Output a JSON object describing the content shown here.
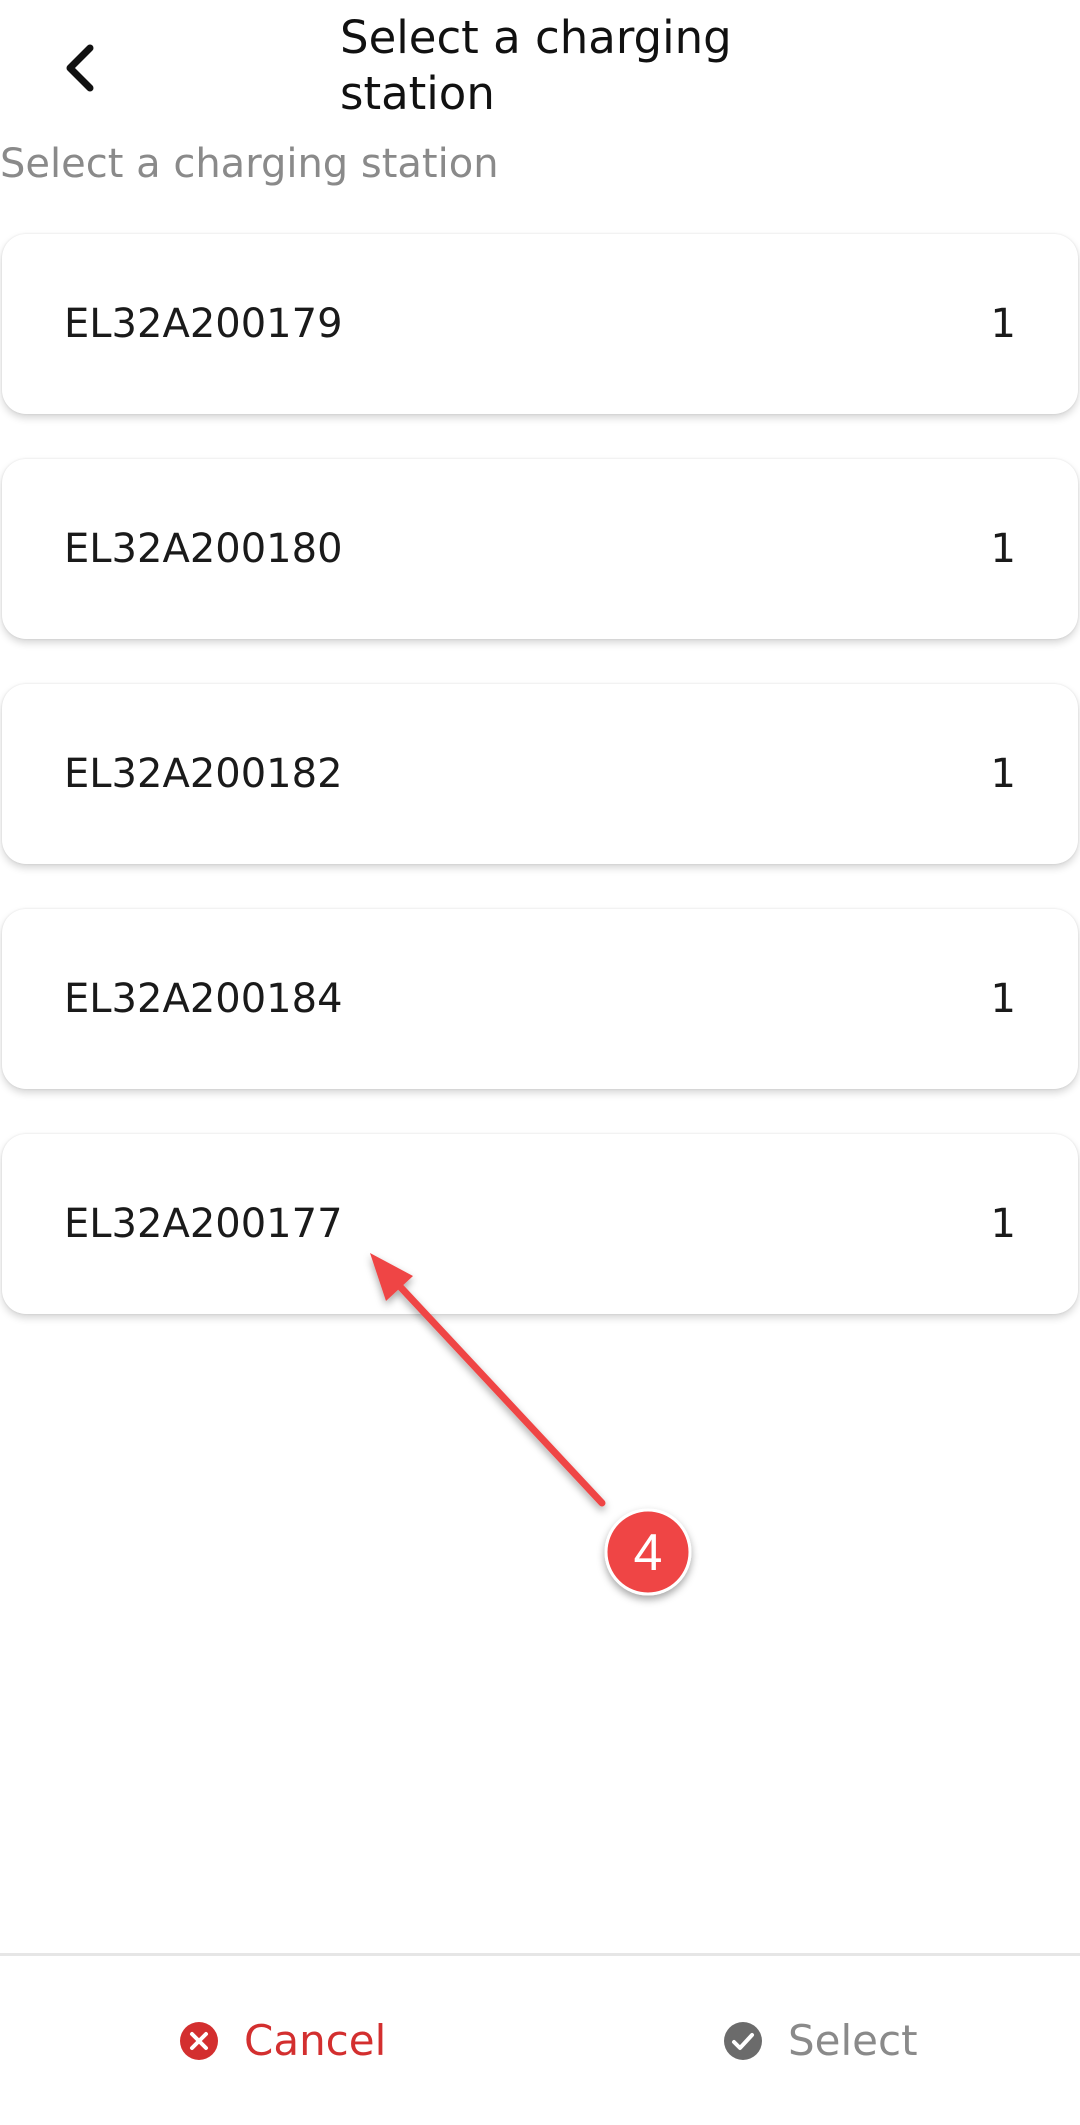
{
  "header": {
    "title": "Select a charging station",
    "back_icon": "chevron-left-icon"
  },
  "subtitle": "Select a charging station",
  "stations": [
    {
      "id": "EL32A200179",
      "count": "1"
    },
    {
      "id": "EL32A200180",
      "count": "1"
    },
    {
      "id": "EL32A200182",
      "count": "1"
    },
    {
      "id": "EL32A200184",
      "count": "1"
    },
    {
      "id": "EL32A200177",
      "count": "1"
    }
  ],
  "annotation": {
    "step_number": "4",
    "color": "#ef4444"
  },
  "footer": {
    "cancel_label": "Cancel",
    "cancel_icon": "close-circle-icon",
    "cancel_color": "#d32f2f",
    "select_label": "Select",
    "select_icon": "check-circle-icon",
    "select_color": "#8a8a8a"
  }
}
